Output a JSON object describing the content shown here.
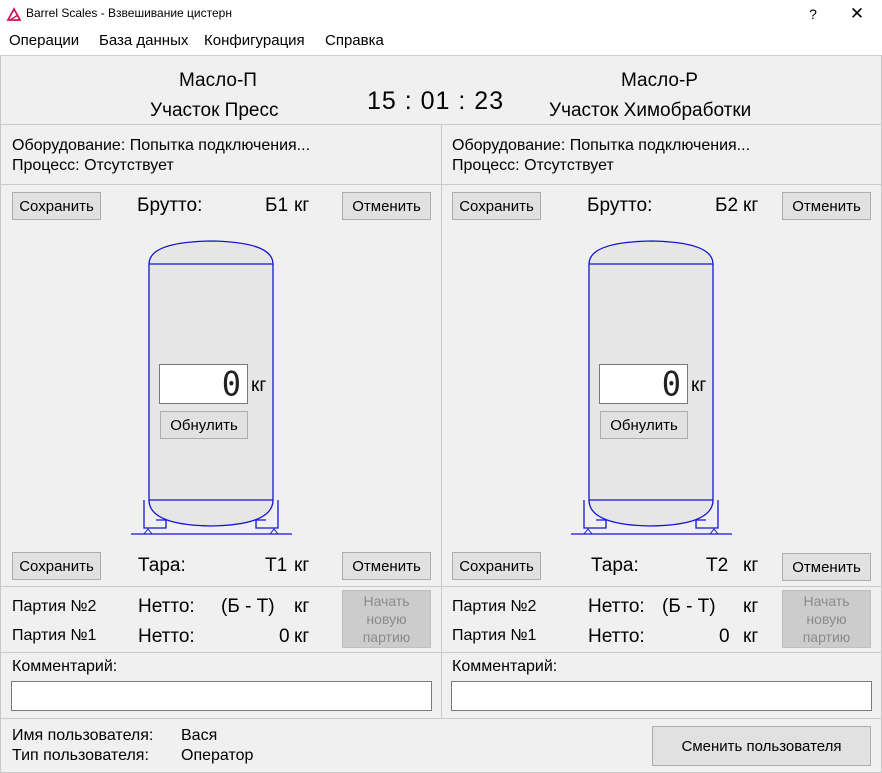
{
  "window": {
    "title": "Barrel Scales - Взвешивание цистерн",
    "help_label": "?",
    "close_label": "✕"
  },
  "menu": {
    "items": [
      "Операции",
      "База данных",
      "Конфигурация",
      "Справка"
    ]
  },
  "header": {
    "left_product": "Масло-П",
    "left_area": "Участок Пресс",
    "clock": "15 : 01 : 23",
    "right_product": "Масло-Р",
    "right_area": "Участок Химобработки"
  },
  "panels": [
    {
      "equipment": "Оборудование: Попытка подключения...",
      "process": "Процесс: Отсутствует",
      "save_label": "Сохранить",
      "cancel_label": "Отменить",
      "gross_label": "Брутто:",
      "gross_value": "Б1",
      "unit": "кг",
      "weight_value": "0",
      "zero_label": "Обнулить",
      "tare_label": "Тара:",
      "tare_value": "Т1",
      "batch2_label": "Партия №2",
      "batch1_label": "Партия №1",
      "net_label": "Нетто:",
      "net_formula": "(Б - Т)",
      "net_value": "0",
      "new_batch_label": "Начать новую партию",
      "comment_label": "Комментарий:",
      "comment_value": ""
    },
    {
      "equipment": "Оборудование: Попытка подключения...",
      "process": "Процесс: Отсутствует",
      "save_label": "Сохранить",
      "cancel_label": "Отменить",
      "gross_label": "Брутто:",
      "gross_value": "Б2",
      "unit": "кг",
      "weight_value": "0",
      "zero_label": "Обнулить",
      "tare_label": "Тара:",
      "tare_value": "Т2",
      "batch2_label": "Партия №2",
      "batch1_label": "Партия №1",
      "net_label": "Нетто:",
      "net_formula": "(Б - Т)",
      "net_value": "0",
      "new_batch_label": "Начать новую партию",
      "comment_label": "Комментарий:",
      "comment_value": ""
    }
  ],
  "footer": {
    "user_name_label": "Имя пользователя:",
    "user_name": "Вася",
    "user_type_label": "Тип пользователя:",
    "user_type": "Оператор",
    "switch_user_label": "Сменить пользователя"
  },
  "colors": {
    "tank_outline": "#1414d2",
    "tank_fill": "#e6e6e6"
  }
}
